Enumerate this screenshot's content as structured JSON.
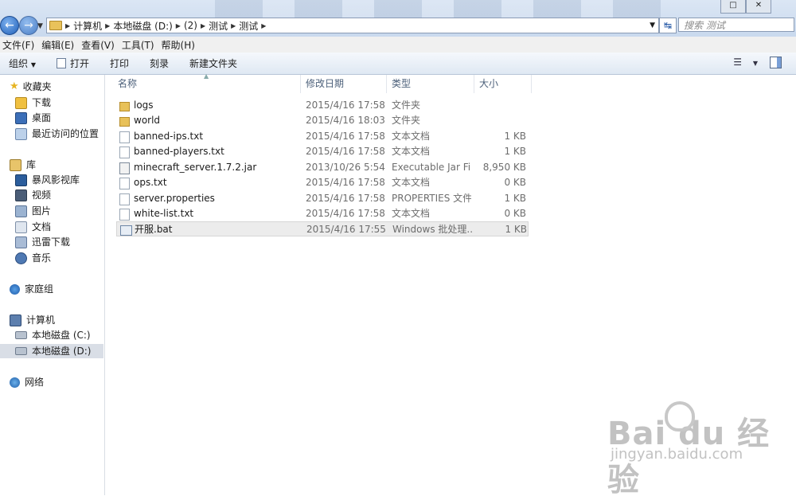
{
  "address": {
    "crumbs": [
      "计算机",
      "本地磁盘 (D:)",
      "(2)",
      "测试",
      "测试"
    ],
    "search_placeholder": "搜索 测试"
  },
  "menu": [
    "文件(F)",
    "编辑(E)",
    "查看(V)",
    "工具(T)",
    "帮助(H)"
  ],
  "toolbar": {
    "organize": "组织",
    "open": "打开",
    "print": "打印",
    "burn": "刻录",
    "new_folder": "新建文件夹"
  },
  "nav": {
    "favorites": "收藏夹",
    "downloads": "下载",
    "desktop": "桌面",
    "recent": "最近访问的位置",
    "libraries": "库",
    "storm": "暴风影视库",
    "videos": "视频",
    "pictures": "图片",
    "documents": "文档",
    "thunder": "迅雷下载",
    "music": "音乐",
    "homegroup": "家庭组",
    "computer": "计算机",
    "drive_c": "本地磁盘 (C:)",
    "drive_d": "本地磁盘 (D:)",
    "network": "网络"
  },
  "columns": {
    "name": "名称",
    "date": "修改日期",
    "type": "类型",
    "size": "大小"
  },
  "files": [
    {
      "name": "logs",
      "date": "2015/4/16 17:58",
      "type": "文件夹",
      "size": "",
      "icon": "folder-icon"
    },
    {
      "name": "world",
      "date": "2015/4/16 18:03",
      "type": "文件夹",
      "size": "",
      "icon": "folder-icon"
    },
    {
      "name": "banned-ips.txt",
      "date": "2015/4/16 17:58",
      "type": "文本文档",
      "size": "1 KB",
      "icon": "text-file-icon"
    },
    {
      "name": "banned-players.txt",
      "date": "2015/4/16 17:58",
      "type": "文本文档",
      "size": "1 KB",
      "icon": "text-file-icon"
    },
    {
      "name": "minecraft_server.1.7.2.jar",
      "date": "2013/10/26 5:54",
      "type": "Executable Jar File",
      "size": "8,950 KB",
      "icon": "jar-file-icon"
    },
    {
      "name": "ops.txt",
      "date": "2015/4/16 17:58",
      "type": "文本文档",
      "size": "0 KB",
      "icon": "text-file-icon"
    },
    {
      "name": "server.properties",
      "date": "2015/4/16 17:58",
      "type": "PROPERTIES 文件",
      "size": "1 KB",
      "icon": "file-icon"
    },
    {
      "name": "white-list.txt",
      "date": "2015/4/16 17:58",
      "type": "文本文档",
      "size": "0 KB",
      "icon": "text-file-icon"
    },
    {
      "name": "开服.bat",
      "date": "2015/4/16 17:55",
      "type": "Windows 批处理...",
      "size": "1 KB",
      "icon": "batch-file-icon"
    }
  ],
  "watermark": {
    "main": "Bai du 经验",
    "sub": "jingyan.baidu.com"
  }
}
